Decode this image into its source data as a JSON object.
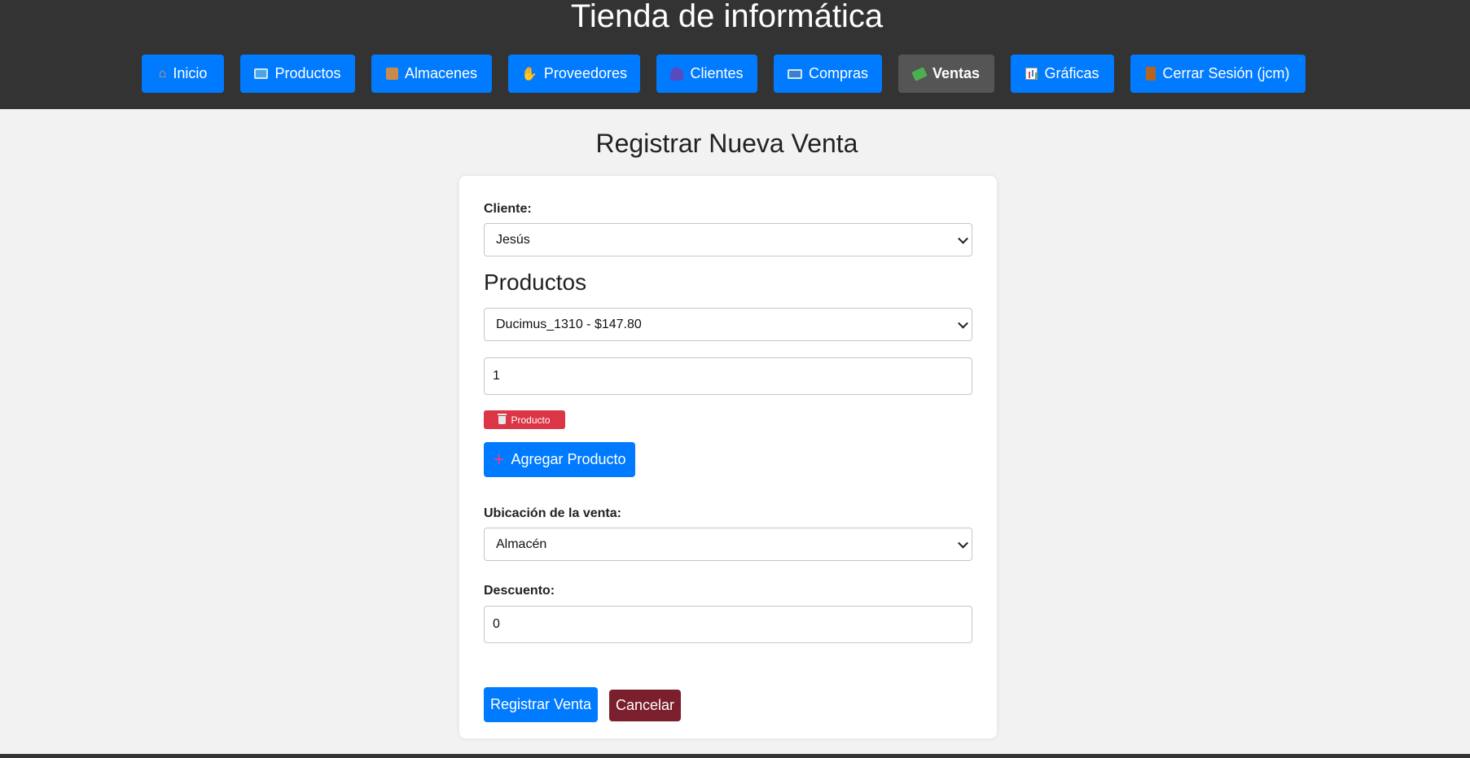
{
  "header": {
    "title": "Tienda de informática",
    "nav": [
      {
        "label": "Inicio",
        "icon": "house-icon"
      },
      {
        "label": "Productos",
        "icon": "monitor-icon"
      },
      {
        "label": "Almacenes",
        "icon": "package-icon"
      },
      {
        "label": "Proveedores",
        "icon": "handshake-icon"
      },
      {
        "label": "Clientes",
        "icon": "user-icon"
      },
      {
        "label": "Compras",
        "icon": "keyboard-icon"
      },
      {
        "label": "Ventas",
        "icon": "money-icon",
        "active": true
      },
      {
        "label": "Gráficas",
        "icon": "chart-icon"
      },
      {
        "label": "Cerrar Sesión (jcm)",
        "icon": "door-icon"
      }
    ]
  },
  "page": {
    "heading": "Registrar Nueva Venta"
  },
  "form": {
    "cliente_label": "Cliente:",
    "cliente_value": "Jesús",
    "productos_title": "Productos",
    "producto_value": "Ducimus_1310 - $147.80",
    "cantidad_value": "1",
    "remove_product_label": "Producto",
    "add_product_label": "Agregar Producto",
    "ubicacion_label": "Ubicación de la venta:",
    "ubicacion_value": "Almacén",
    "descuento_label": "Descuento:",
    "descuento_value": "0",
    "submit_label": "Registrar Venta",
    "cancel_label": "Cancelar"
  },
  "colors": {
    "header_bg": "#333333",
    "primary": "#007bff",
    "active_nav": "#555555",
    "danger": "#dc3545",
    "cancel": "#7a1f2b",
    "page_bg": "#f2f2f2"
  }
}
